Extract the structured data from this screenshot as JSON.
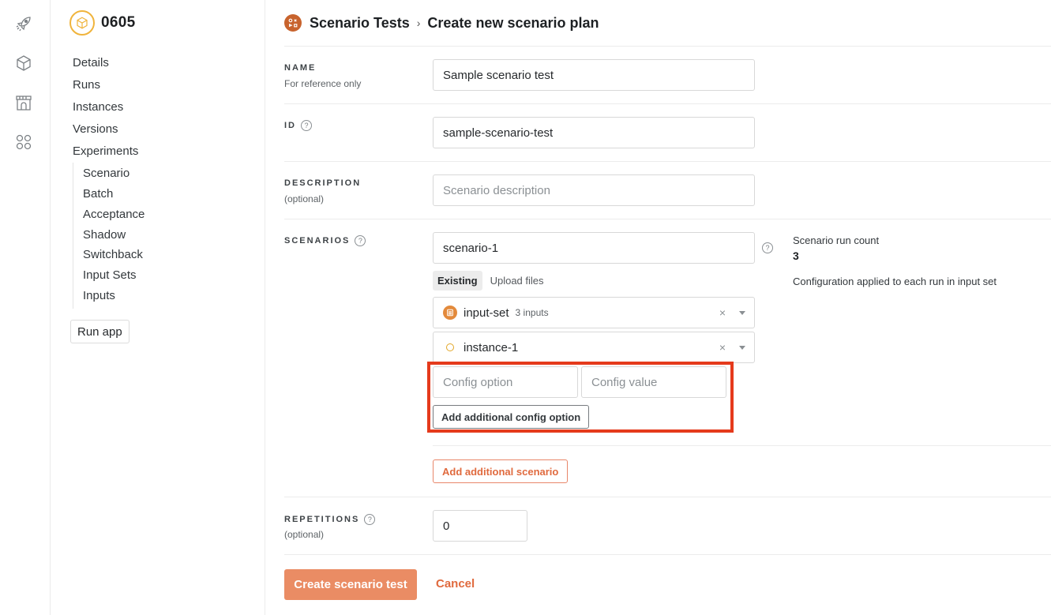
{
  "rail": {
    "icons": [
      "rocket-icon",
      "cube-icon",
      "marketplace-icon",
      "apps-grid-icon"
    ]
  },
  "app": {
    "title": "0605",
    "nav": [
      "Details",
      "Runs",
      "Instances",
      "Versions",
      "Experiments"
    ],
    "subnav": [
      "Scenario",
      "Batch",
      "Acceptance",
      "Shadow",
      "Switchback",
      "Input Sets",
      "Inputs"
    ],
    "run_app_label": "Run app"
  },
  "breadcrumb": {
    "parent": "Scenario Tests",
    "separator": "›",
    "current": "Create new scenario plan"
  },
  "form": {
    "name": {
      "label": "NAME",
      "sublabel": "For reference only",
      "value": "Sample scenario test"
    },
    "id": {
      "label": "ID",
      "value": "sample-scenario-test"
    },
    "description": {
      "label": "DESCRIPTION",
      "sublabel": "(optional)",
      "placeholder": "Scenario description"
    },
    "scenarios": {
      "label": "SCENARIOS",
      "scenario_name": "scenario-1",
      "source_tabs": [
        "Existing",
        "Upload files"
      ],
      "active_tab": "Existing",
      "input_set": {
        "name": "input-set",
        "meta": "3 inputs"
      },
      "instance": {
        "name": "instance-1"
      },
      "config_option_placeholder": "Config option",
      "config_value_placeholder": "Config value",
      "add_config_label": "Add additional config option",
      "add_scenario_label": "Add additional scenario",
      "run_count_label": "Scenario run count",
      "run_count_value": "3",
      "config_note": "Configuration applied to each run in input set"
    },
    "repetitions": {
      "label": "REPETITIONS",
      "sublabel": "(optional)",
      "value": "0"
    },
    "submit_label": "Create scenario test",
    "cancel_label": "Cancel"
  },
  "help_glyph": "?",
  "clear_glyph": "×",
  "colors": {
    "accent": "#ea8c64",
    "accent_text": "#e06a3e",
    "app_logo": "#f0b43c",
    "annotation": "#e53a1c"
  }
}
